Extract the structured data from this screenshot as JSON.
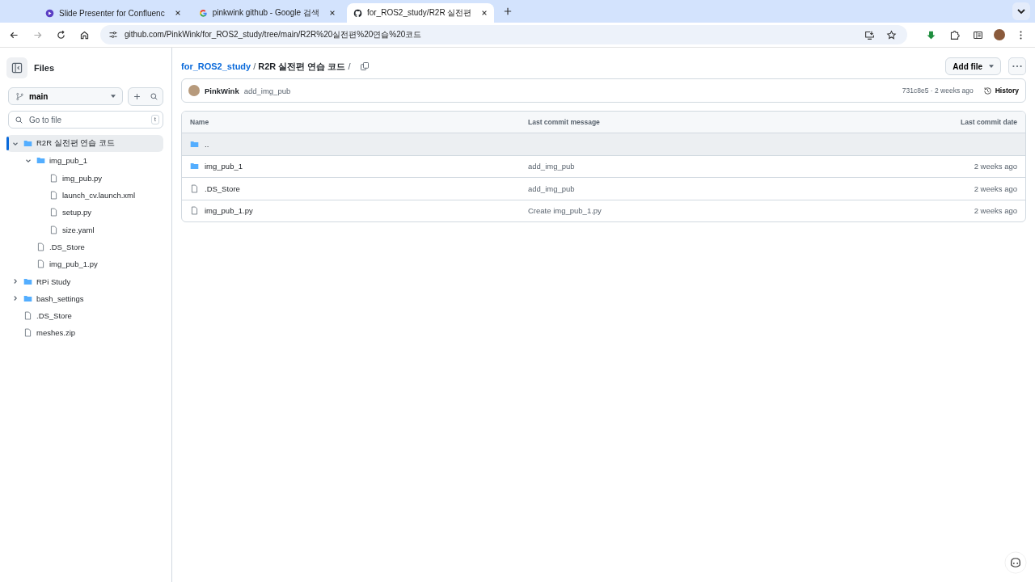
{
  "browser": {
    "tabs": [
      {
        "title": "Slide Presenter for Confluenc",
        "kind": "slides",
        "selected": false
      },
      {
        "title": "pinkwink github - Google 검색",
        "kind": "google",
        "selected": false
      },
      {
        "title": "for_ROS2_study/R2R 실전편",
        "kind": "github",
        "selected": true
      }
    ],
    "url": "github.com/PinkWink/for_ROS2_study/tree/main/R2R%20실전편%20연습%20코드"
  },
  "sidebar": {
    "title": "Files",
    "branch": "main",
    "search": {
      "placeholder": "Go to file",
      "shortcut": "t"
    },
    "tree": [
      {
        "name": "R2R 실전편 연습 코드",
        "kind": "folder",
        "expanded": true,
        "selected": true,
        "children": [
          {
            "name": "img_pub_1",
            "kind": "folder",
            "expanded": true,
            "selected": false,
            "children": [
              {
                "name": "img_pub.py",
                "kind": "file",
                "selected": false
              },
              {
                "name": "launch_cv.launch.xml",
                "kind": "file",
                "selected": false
              },
              {
                "name": "setup.py",
                "kind": "file",
                "selected": false
              },
              {
                "name": "size.yaml",
                "kind": "file",
                "selected": false
              }
            ]
          },
          {
            "name": ".DS_Store",
            "kind": "file",
            "selected": false
          },
          {
            "name": "img_pub_1.py",
            "kind": "file",
            "selected": false
          }
        ]
      },
      {
        "name": "RPi Study",
        "kind": "folder",
        "expanded": false,
        "selected": false
      },
      {
        "name": "bash_settings",
        "kind": "folder",
        "expanded": false,
        "selected": false
      },
      {
        "name": ".DS_Store",
        "kind": "file",
        "selected": false
      },
      {
        "name": "meshes.zip",
        "kind": "file",
        "selected": false
      }
    ]
  },
  "breadcrumb": {
    "repo": "for_ROS2_study",
    "path": "R2R 실전편 연습 코드",
    "separator": "/"
  },
  "add_file_button": "Add file",
  "latest_commit": {
    "author": "PinkWink",
    "message": "add_img_pub",
    "hash": "731c8e5",
    "separator": "·",
    "time": "2 weeks ago",
    "history": "History"
  },
  "table": {
    "columns": [
      "Name",
      "Last commit message",
      "Last commit date"
    ],
    "rows": [
      {
        "name": "..",
        "kind": "folder",
        "hovered": true
      },
      {
        "name": "img_pub_1",
        "kind": "folder",
        "hovered": false,
        "message": "add_img_pub",
        "date": "2 weeks ago"
      },
      {
        "name": ".DS_Store",
        "kind": "file",
        "hovered": false,
        "message": "add_img_pub",
        "date": "2 weeks ago"
      },
      {
        "name": "img_pub_1.py",
        "kind": "file",
        "hovered": false,
        "message": "Create img_pub_1.py",
        "date": "2 weeks ago"
      }
    ]
  }
}
